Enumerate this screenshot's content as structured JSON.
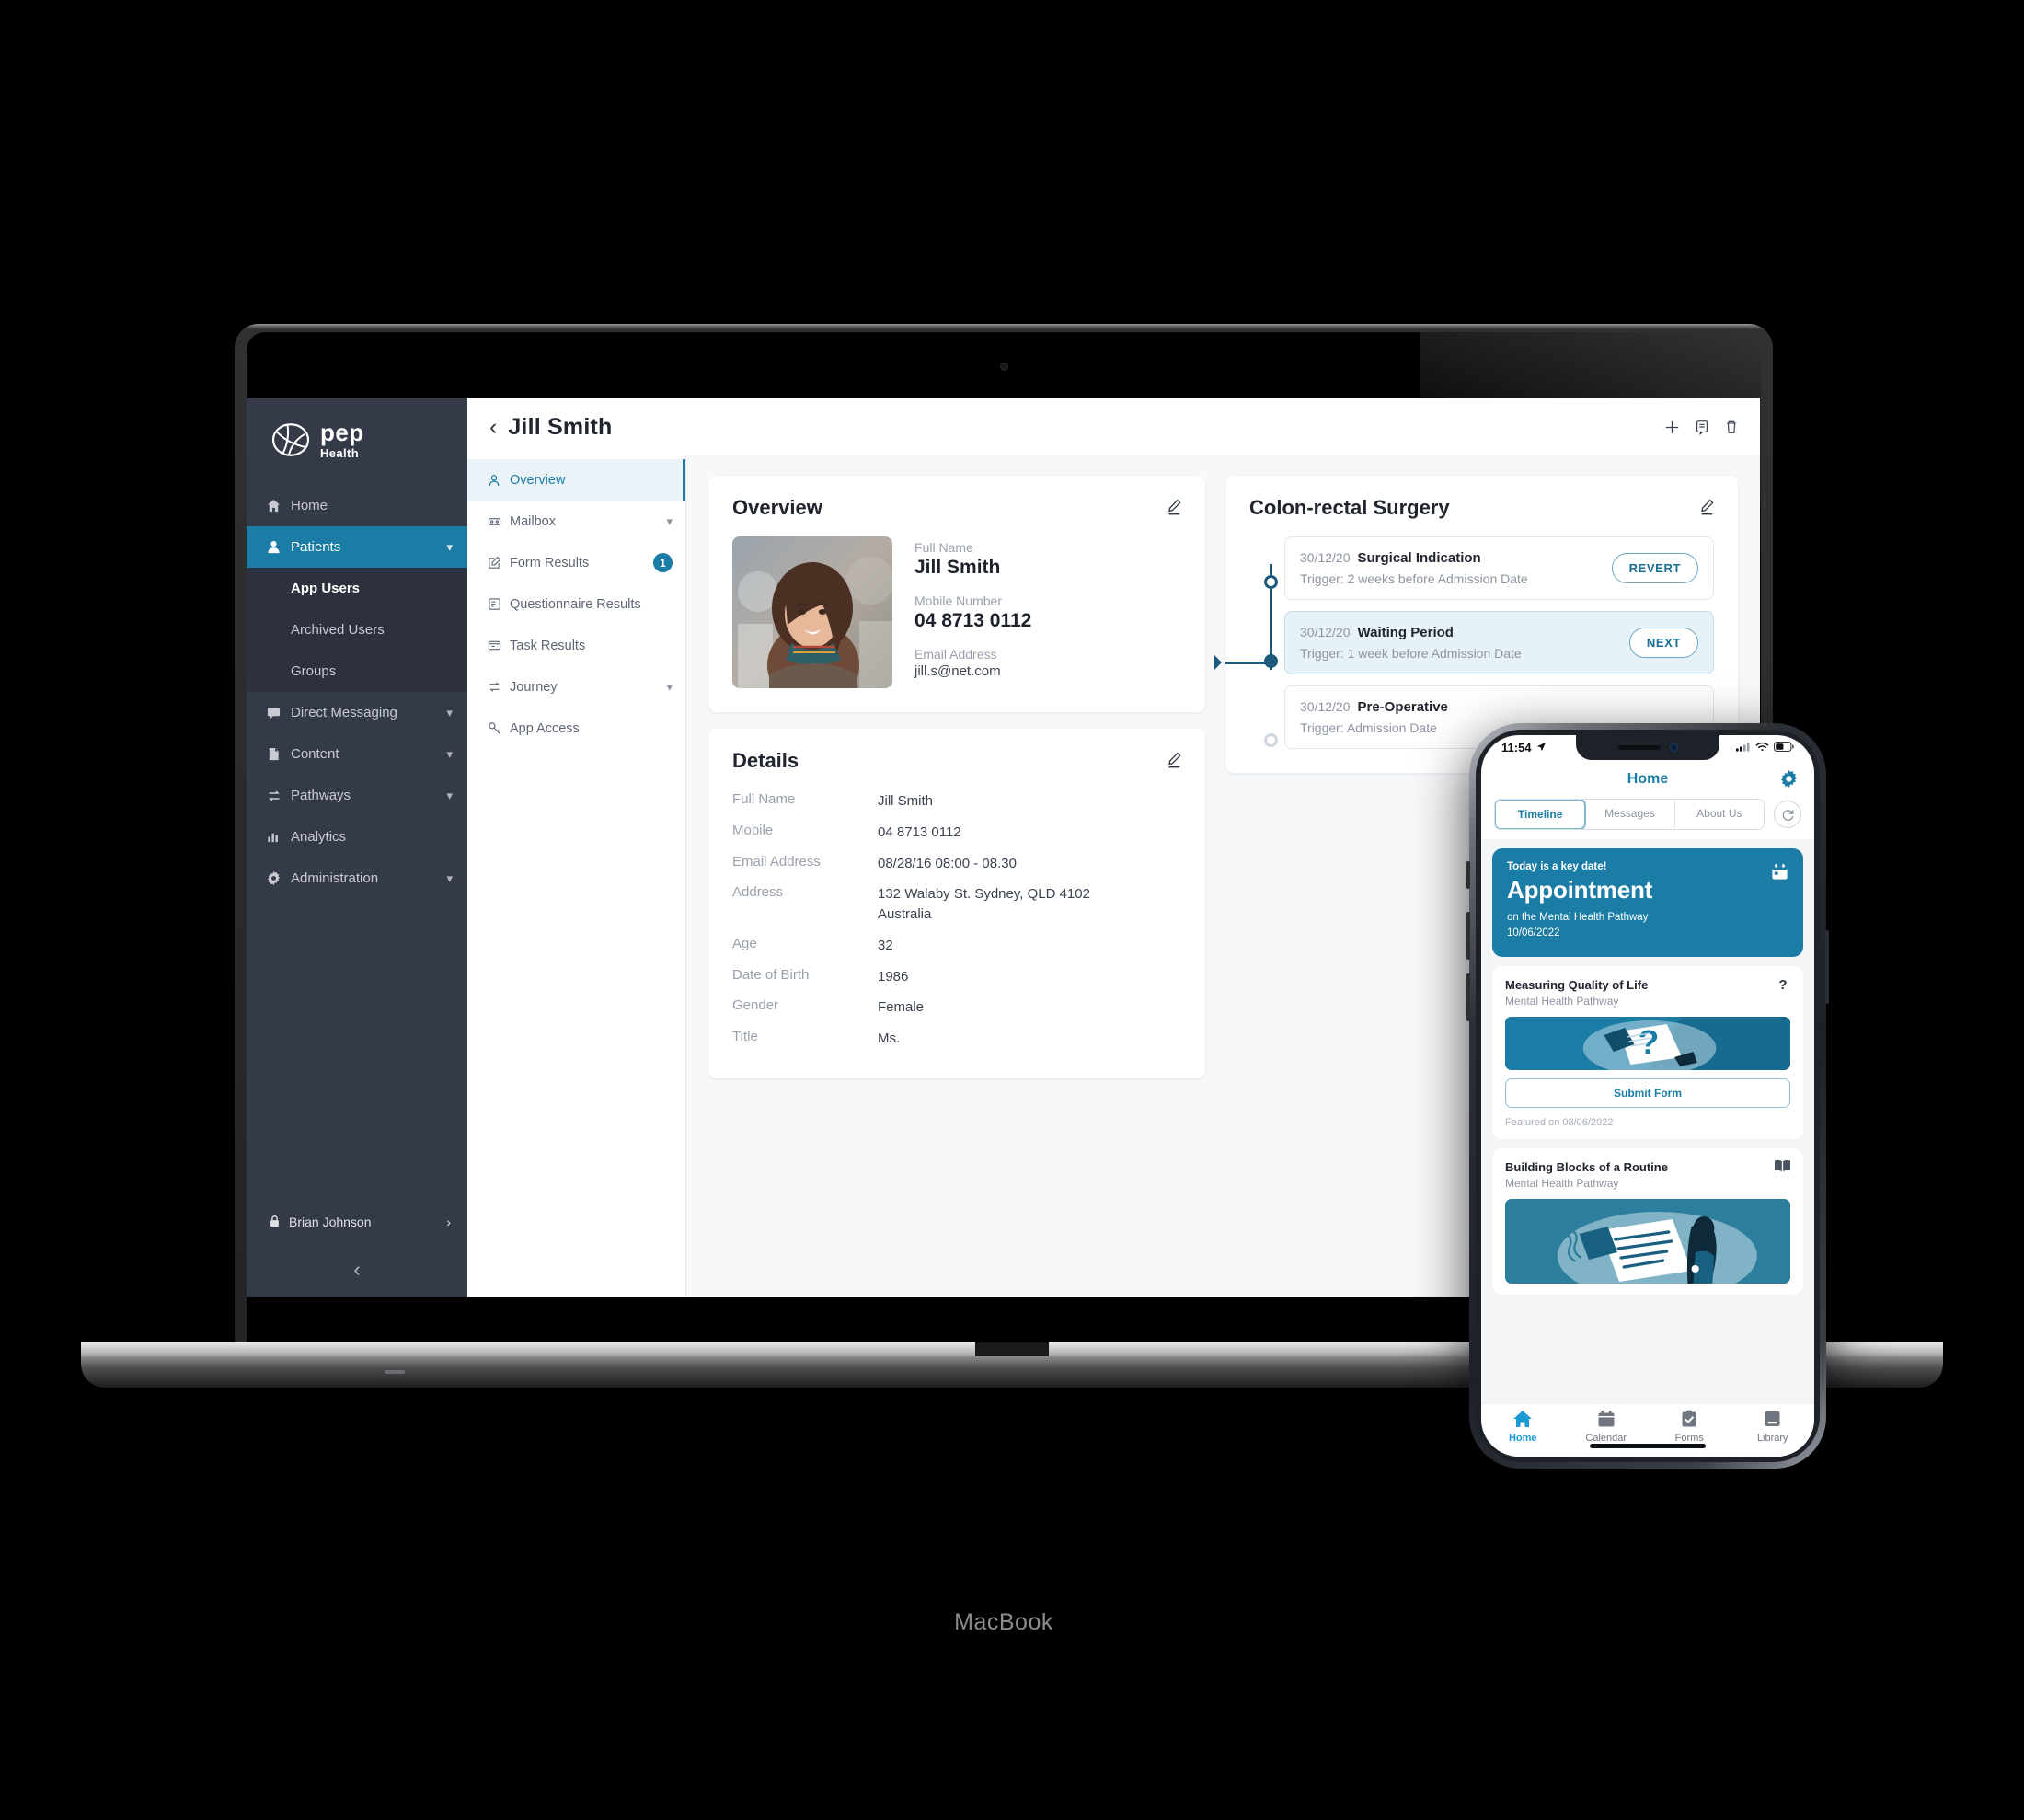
{
  "device": {
    "laptop_label": "MacBook"
  },
  "sidebar": {
    "brand": {
      "name": "pep",
      "sub": "Health",
      "logo_icon": "pep-logo-icon"
    },
    "items": [
      {
        "label": "Home",
        "icon": "home-icon",
        "active": false,
        "expandable": false
      },
      {
        "label": "Patients",
        "icon": "user-icon",
        "active": true,
        "expandable": true
      },
      {
        "label": "Direct Messaging",
        "icon": "message-icon",
        "active": false,
        "expandable": true
      },
      {
        "label": "Content",
        "icon": "document-icon",
        "active": false,
        "expandable": true
      },
      {
        "label": "Pathways",
        "icon": "pathways-icon",
        "active": false,
        "expandable": true
      },
      {
        "label": "Analytics",
        "icon": "chart-icon",
        "active": false,
        "expandable": false
      },
      {
        "label": "Administration",
        "icon": "gear-icon",
        "active": false,
        "expandable": true
      }
    ],
    "sub_items": [
      {
        "label": "App Users",
        "selected": true
      },
      {
        "label": "Archived Users",
        "selected": false
      },
      {
        "label": "Groups",
        "selected": false
      }
    ],
    "user": {
      "name": "Brian Johnson",
      "icon": "lock-icon",
      "chevron": "›"
    },
    "collapse_icon": "chevron-left-icon"
  },
  "topbar": {
    "back_icon": "chevron-left-icon",
    "title": "Jill Smith",
    "actions": [
      {
        "name": "add-icon"
      },
      {
        "name": "note-icon"
      },
      {
        "name": "delete-icon"
      }
    ]
  },
  "subnav": {
    "items": [
      {
        "label": "Overview",
        "icon": "person-icon",
        "active": true,
        "chevron": false,
        "badge": null
      },
      {
        "label": "Mailbox",
        "icon": "mailbox-icon",
        "active": false,
        "chevron": true,
        "badge": null
      },
      {
        "label": "Form Results",
        "icon": "form-icon",
        "active": false,
        "chevron": false,
        "badge": "1"
      },
      {
        "label": "Questionnaire Results",
        "icon": "questionnaire-icon",
        "active": false,
        "chevron": false,
        "badge": null
      },
      {
        "label": "Task Results",
        "icon": "task-icon",
        "active": false,
        "chevron": false,
        "badge": null
      },
      {
        "label": "Journey",
        "icon": "journey-icon",
        "active": false,
        "chevron": true,
        "badge": null
      },
      {
        "label": "App Access",
        "icon": "key-icon",
        "active": false,
        "chevron": false,
        "badge": null
      }
    ]
  },
  "overview_card": {
    "title": "Overview",
    "edit_icon": "edit-pencil-icon",
    "photo_alt": "patient-photo",
    "fields": [
      {
        "label": "Full Name",
        "value": "Jill Smith",
        "emphasis": true
      },
      {
        "label": "Mobile Number",
        "value": "04 8713 0112",
        "emphasis": true
      },
      {
        "label": "Email Address",
        "value": "jill.s@net.com",
        "emphasis": false
      }
    ]
  },
  "details_card": {
    "title": "Details",
    "edit_icon": "edit-pencil-icon",
    "rows": [
      {
        "key": "Full Name",
        "value": "Jill Smith"
      },
      {
        "key": "Mobile",
        "value": "04 8713 0112"
      },
      {
        "key": "Email Address",
        "value": "08/28/16 08:00 - 08.30"
      },
      {
        "key": "Address",
        "value": "132 Walaby St. Sydney, QLD 4102\nAustralia"
      },
      {
        "key": "Age",
        "value": "32"
      },
      {
        "key": "Date of Birth",
        "value": "1986"
      },
      {
        "key": "Gender",
        "value": "Female"
      },
      {
        "key": "Title",
        "value": "Ms."
      }
    ]
  },
  "pathway_card": {
    "title": "Colon-rectal Surgery",
    "edit_icon": "edit-pencil-icon",
    "steps": [
      {
        "date": "30/12/20",
        "name": "Surgical Indication",
        "trigger": "Trigger: 2 weeks before Admission Date",
        "button": "REVERT",
        "state": "done"
      },
      {
        "date": "30/12/20",
        "name": "Waiting Period",
        "trigger": "Trigger: 1 week before Admission Date",
        "button": "NEXT",
        "state": "current"
      },
      {
        "date": "30/12/20",
        "name": "Pre-Operative",
        "trigger": "Trigger: Admission Date",
        "button": null,
        "state": "upcoming"
      }
    ]
  },
  "phone": {
    "status": {
      "time": "11:54",
      "location_icon": "location-arrow-icon",
      "signal_icon": "cellular-icon",
      "wifi_icon": "wifi-icon",
      "battery_icon": "battery-icon"
    },
    "header": {
      "title": "Home",
      "settings_icon": "gear-icon"
    },
    "tabs": [
      {
        "label": "Timeline",
        "active": true
      },
      {
        "label": "Messages",
        "active": false
      },
      {
        "label": "About Us",
        "active": false
      }
    ],
    "refresh_icon": "refresh-icon",
    "hero": {
      "kicker": "Today is a key date!",
      "title": "Appointment",
      "subtitle": "on the Mental Health Pathway",
      "date": "10/06/2022",
      "icon": "calendar-icon"
    },
    "cards": [
      {
        "title": "Measuring Quality of Life",
        "subtitle": "Mental Health Pathway",
        "icon": "question-mark-icon",
        "image": "question-illustration",
        "button": "Submit Form",
        "footer": "Featured on 08/06/2022"
      },
      {
        "title": "Building Blocks of a Routine",
        "subtitle": "Mental Health Pathway",
        "icon": "book-icon",
        "image": "routine-illustration",
        "button": null,
        "footer": null
      }
    ],
    "tabbar": [
      {
        "label": "Home",
        "icon": "home-icon",
        "active": true
      },
      {
        "label": "Calendar",
        "icon": "calendar-icon",
        "active": false
      },
      {
        "label": "Forms",
        "icon": "clipboard-check-icon",
        "active": false
      },
      {
        "label": "Library",
        "icon": "book-icon",
        "active": false
      }
    ]
  },
  "colors": {
    "accent": "#1b7ca6",
    "sidebar_bg": "#343a48",
    "sidebar_sub_bg": "#2c313d",
    "rail": "#1b5a7a",
    "tab_active": "#1b9ad6"
  }
}
